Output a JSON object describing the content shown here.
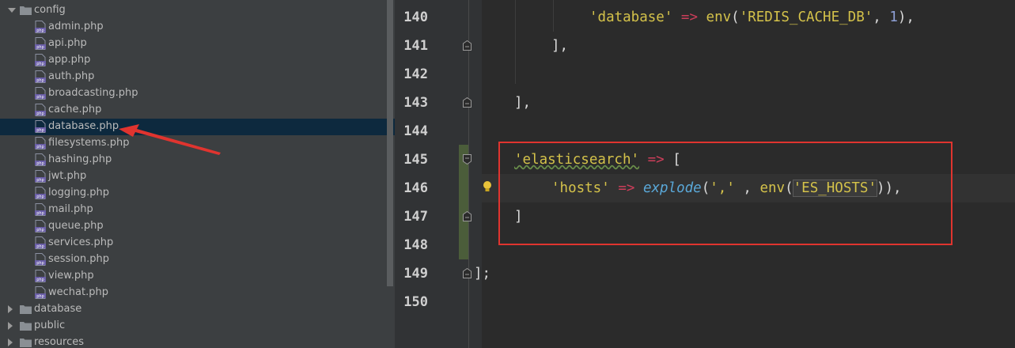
{
  "tree": {
    "config_folder": "config",
    "files": [
      "admin.php",
      "api.php",
      "app.php",
      "auth.php",
      "broadcasting.php",
      "cache.php",
      "database.php",
      "filesystems.php",
      "hashing.php",
      "jwt.php",
      "logging.php",
      "mail.php",
      "queue.php",
      "services.php",
      "session.php",
      "view.php",
      "wechat.php"
    ],
    "selected_file": "database.php",
    "sibling_folders": [
      "database",
      "public",
      "resources"
    ]
  },
  "editor": {
    "line_numbers": [
      "140",
      "141",
      "142",
      "143",
      "144",
      "145",
      "146",
      "147",
      "148",
      "149",
      "150"
    ],
    "line140": {
      "str1": "'database'",
      "op": "=>",
      "fn": "env",
      "p1": "(",
      "str2": "'REDIS_CACHE_DB'",
      "sep": ", ",
      "num": "1",
      "p2": "),"
    },
    "line141": "],",
    "line143": "],",
    "line145": {
      "str": "'elasticsearch'",
      "op": "=>",
      "br": "["
    },
    "line146": {
      "str1": "'hosts'",
      "op": "=>",
      "fn1": "explode",
      "p1": "(",
      "str2": "','",
      "sep": " , ",
      "fn2": "env",
      "p2": "(",
      "str3": "'ES_HOSTS'",
      "p3": ")),"
    },
    "line147": "]",
    "line149": "];"
  },
  "colors": {
    "highlight_box": "#e0342f",
    "arrow": "#e0342f",
    "selected_row": "#0d293e"
  }
}
